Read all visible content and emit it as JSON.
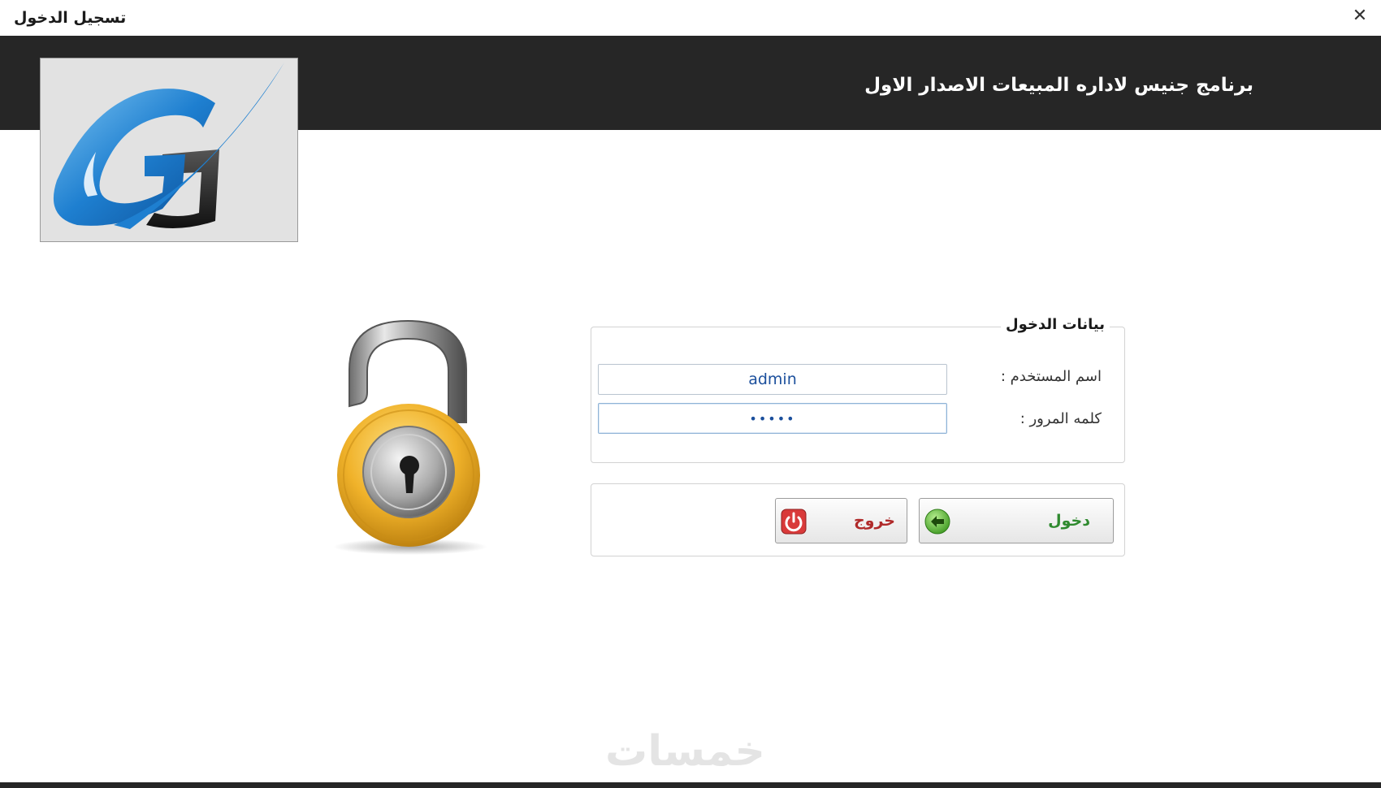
{
  "window": {
    "title": "تسجيل الدخول",
    "close_symbol": "✕"
  },
  "header": {
    "app_title": "برنامج جنيس لاداره المبيعات الاصدار الاول"
  },
  "login_form": {
    "legend": "بيانات الدخول",
    "username_label": "اسم المستخدم :",
    "username_value": "admin",
    "password_label": "كلمه المرور :",
    "password_value": "•••••"
  },
  "buttons": {
    "login_label": "دخول",
    "login_icon": "arrow-left-circle-icon",
    "exit_label": "خروج",
    "exit_icon": "power-icon"
  },
  "watermark": {
    "text": "خمسات"
  },
  "colors": {
    "header_bg": "#262626",
    "login_green": "#2f8a2f",
    "exit_red": "#b02a2a",
    "input_text_blue": "#1b4f9c"
  }
}
